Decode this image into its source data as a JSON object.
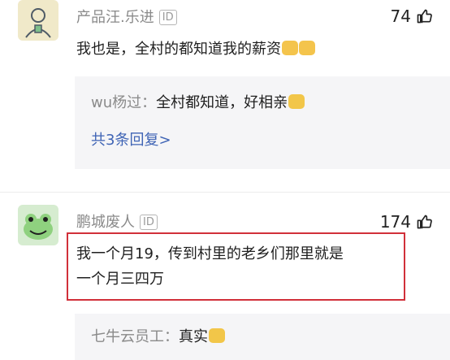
{
  "comments": [
    {
      "name": "产品汪.乐进",
      "badge": "ID",
      "likes": "74",
      "text": "我也是，全村的都知道我的薪资",
      "replies": [
        {
          "author": "wu杨过：",
          "text": "全村都知道，好相亲"
        }
      ],
      "reply_count_label": "共3条回复>"
    },
    {
      "name": "鹏城废人",
      "badge": "ID",
      "likes": "174",
      "text_line1": "我一个月19，传到村里的老乡们那里就是",
      "text_line2": "一个月三四万",
      "replies": [
        {
          "author": "七牛云员工：",
          "text": "真实"
        }
      ]
    }
  ],
  "colors": {
    "highlight_border": "#d1303a",
    "reply_link": "#3f64b5",
    "reply_bg": "#f5f5f7"
  },
  "icons": [
    "avatar-person",
    "avatar-frog",
    "thumbs-up-icon",
    "emoji"
  ]
}
